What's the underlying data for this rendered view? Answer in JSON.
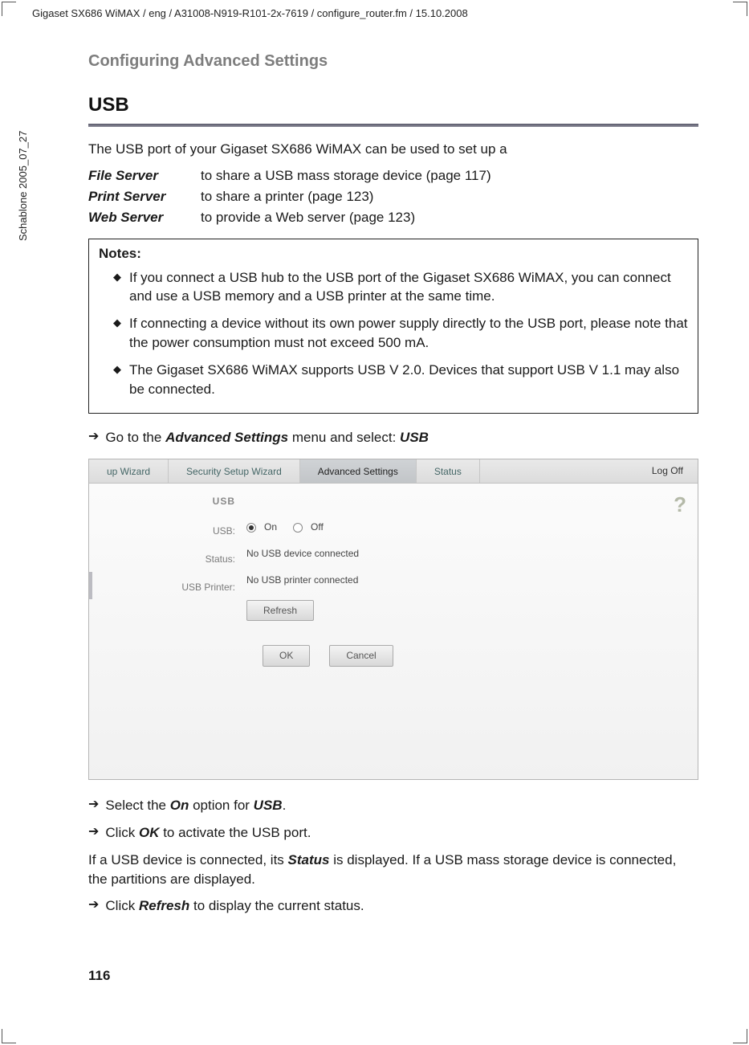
{
  "header_path": "Gigaset SX686 WiMAX / eng / A31008-N919-R101-2x-7619 / configure_router.fm / 15.10.2008",
  "side_label": "Schablone 2005_07_27",
  "section_heading": "Configuring Advanced Settings",
  "h1": "USB",
  "intro": "The USB port of your Gigaset SX686 WiMAX can be used to set up a",
  "defs": [
    {
      "term": "File Server",
      "desc": "to share a USB mass storage device (page 117)"
    },
    {
      "term": "Print Server",
      "desc": "to share a printer (page 123)"
    },
    {
      "term": "Web Server",
      "desc": "to provide a Web server (page 123)"
    }
  ],
  "notes_title": "Notes:",
  "notes": [
    "If you connect a USB hub to the USB port of the Gigaset SX686 WiMAX, you can connect and use a USB memory and a USB printer at the same time.",
    "If connecting a device without its own power supply directly to the USB port, please note that the power consumption must not exceed 500 mA.",
    "The Gigaset SX686 WiMAX supports USB V 2.0. Devices that support USB V 1.1 may also be connected."
  ],
  "step_pre": "Go to the ",
  "step_mid": "Advanced Settings",
  "step_mid2": " menu and select: ",
  "step_end": "USB",
  "ui": {
    "tabs": [
      "up Wizard",
      "Security Setup Wizard",
      "Advanced Settings",
      "Status"
    ],
    "logoff": "Log Off",
    "hdr": "USB",
    "labels": {
      "usb": "USB:",
      "status": "Status:",
      "printer": "USB Printer:"
    },
    "on": "On",
    "off": "Off",
    "status_val": "No USB device connected",
    "printer_val": "No USB printer connected",
    "refresh": "Refresh",
    "ok": "OK",
    "cancel": "Cancel"
  },
  "step2a": "Select the ",
  "step2b": "On",
  "step2c": " option for ",
  "step2d": "USB",
  "step2e": ".",
  "step3a": "Click ",
  "step3b": "OK",
  "step3c": " to activate the USB port.",
  "para_a": "If a USB device is connected, its ",
  "para_b": "Status",
  "para_c": " is displayed. If a USB mass storage device is connected, the partitions are displayed.",
  "step4a": "Click ",
  "step4b": "Refresh",
  "step4c": " to display the current status.",
  "page_number": "116"
}
